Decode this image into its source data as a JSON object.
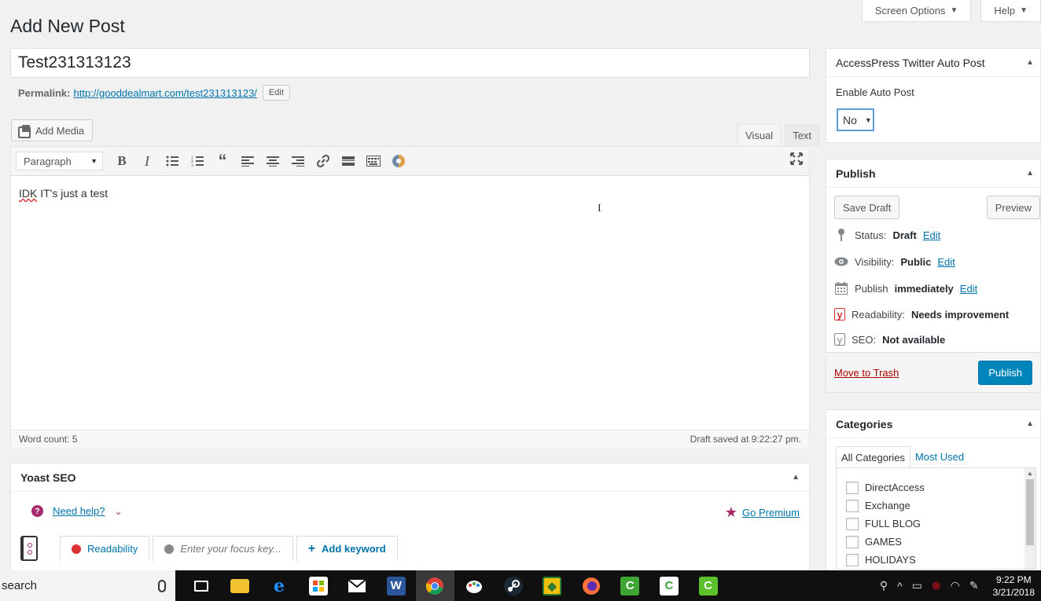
{
  "screen_tabs": {
    "screen_options": "Screen Options",
    "help": "Help"
  },
  "page_title": "Add New Post",
  "post": {
    "title": "Test231313123",
    "permalink_label": "Permalink:",
    "permalink_url": "http://gooddealmart.com/test231313123/",
    "permalink_edit": "Edit",
    "content_word_flagged": "IDK",
    "content_rest": " IT's just a test"
  },
  "media": {
    "add_media_label": "Add Media"
  },
  "editor": {
    "tabs": [
      "Visual",
      "Text"
    ],
    "active_tab": "Visual",
    "format": "Paragraph",
    "word_count": "Word count: 5",
    "draft_saved": "Draft saved at 9:22:27 pm.",
    "cursor_glyph": "I"
  },
  "yoast": {
    "title": "Yoast SEO",
    "need_help": "Need help?",
    "go_premium": "Go Premium",
    "tabs": {
      "readability": "Readability",
      "focus_placeholder": "Enter your focus key...",
      "add_keyword": "Add keyword"
    }
  },
  "twitter_box": {
    "title": "AccessPress Twitter Auto Post",
    "enable_label": "Enable Auto Post",
    "enable_value": "No"
  },
  "publish_box": {
    "title": "Publish",
    "save_draft": "Save Draft",
    "preview": "Preview",
    "status_label": "Status:",
    "status_value": "Draft",
    "status_edit": "Edit",
    "visibility_label": "Visibility:",
    "visibility_value": "Public",
    "visibility_edit": "Edit",
    "publish_label": "Publish",
    "publish_value": "immediately",
    "publish_edit": "Edit",
    "readability_label": "Readability:",
    "readability_value": "Needs improvement",
    "seo_label": "SEO:",
    "seo_value": "Not available",
    "trash": "Move to Trash",
    "publish_button": "Publish"
  },
  "categories_box": {
    "title": "Categories",
    "tabs": [
      "All Categories",
      "Most Used"
    ],
    "items": [
      "DirectAccess",
      "Exchange",
      "FULL BLOG",
      "GAMES",
      "HOLIDAYS"
    ]
  },
  "taskbar": {
    "search_text": "search",
    "time": "9:22 PM",
    "date": "3/21/2018",
    "apps": [
      "task-view",
      "file-explorer",
      "edge",
      "store",
      "mail",
      "word",
      "chrome",
      "paint",
      "steam",
      "app-yellow",
      "firefox",
      "camtasia-1",
      "camtasia-2",
      "camtasia-3"
    ]
  },
  "colors": {
    "wp_blue": "#0073aa",
    "primary_button": "#0085ba",
    "yoast_purple": "#a4286a",
    "danger": "#dc3232",
    "trash": "#a00"
  }
}
